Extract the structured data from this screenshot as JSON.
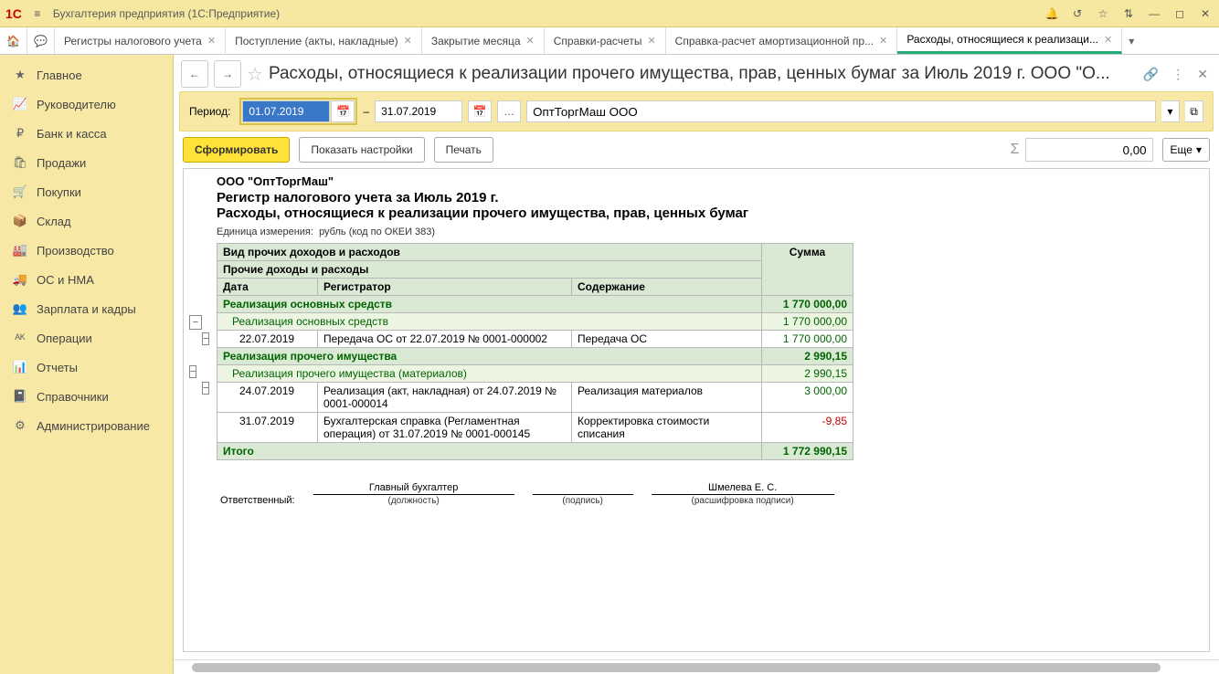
{
  "titlebar": {
    "app": "Бухгалтерия предприятия  (1С:Предприятие)"
  },
  "tabs": [
    "Регистры налогового учета",
    "Поступление (акты, накладные)",
    "Закрытие месяца",
    "Справки-расчеты",
    "Справка-расчет амортизационной пр...",
    "Расходы, относящиеся к реализаци..."
  ],
  "sidebar": [
    "Главное",
    "Руководителю",
    "Банк и касса",
    "Продажи",
    "Покупки",
    "Склад",
    "Производство",
    "ОС и НМА",
    "Зарплата и кадры",
    "Операции",
    "Отчеты",
    "Справочники",
    "Администрирование"
  ],
  "page": {
    "title": "Расходы, относящиеся к реализации прочего имущества, прав, ценных бумаг за Июль 2019 г. ООО \"О...",
    "period_label": "Период:",
    "date_from": "01.07.2019",
    "date_to": "31.07.2019",
    "org": "ОптТоргМаш ООО",
    "btn_form": "Сформировать",
    "btn_settings": "Показать настройки",
    "btn_print": "Печать",
    "sum_val": "0,00",
    "more": "Еще"
  },
  "report": {
    "org_head": "ООО \"ОптТоргМаш\"",
    "title1": "Регистр налогового учета за Июль 2019 г.",
    "title2": "Расходы, относящиеся к реализации прочего имущества, прав, ценных бумаг",
    "unit_label": "Единица измерения:",
    "unit_val": "рубль (код по ОКЕИ 383)",
    "hdr_group1": "Вид прочих доходов и расходов",
    "hdr_group2": "Прочие доходы и расходы",
    "hdr_sum": "Сумма",
    "hdr_date": "Дата",
    "hdr_reg": "Регистратор",
    "hdr_cont": "Содержание",
    "rows": {
      "g1": {
        "label": "Реализация основных средств",
        "amt": "1 770 000,00"
      },
      "g1s": {
        "label": "Реализация основных средств",
        "amt": "1 770 000,00"
      },
      "r1": {
        "date": "22.07.2019",
        "reg": "Передача ОС от 22.07.2019 № 0001-000002",
        "cont": "Передача ОС",
        "amt": "1 770 000,00"
      },
      "g2": {
        "label": "Реализация прочего имущества",
        "amt": "2 990,15"
      },
      "g2s": {
        "label": "Реализация прочего имущества (материалов)",
        "amt": "2 990,15"
      },
      "r2": {
        "date": "24.07.2019",
        "reg": "Реализация (акт, накладная) от 24.07.2019 № 0001-000014",
        "cont": "Реализация материалов",
        "amt": "3 000,00"
      },
      "r3": {
        "date": "31.07.2019",
        "reg": "Бухгалтерская справка (Регламентная операция) от 31.07.2019 № 0001-000145",
        "cont": "Корректировка стоимости списания",
        "amt": "-9,85"
      },
      "total_label": "Итого",
      "total": "1 772 990,15"
    },
    "sign": {
      "resp": "Ответственный:",
      "pos": "Главный бухгалтер",
      "pos_under": "(должность)",
      "sig_under": "(подпись)",
      "name": "Шмелева Е. С.",
      "name_under": "(расшифровка подписи)"
    }
  }
}
